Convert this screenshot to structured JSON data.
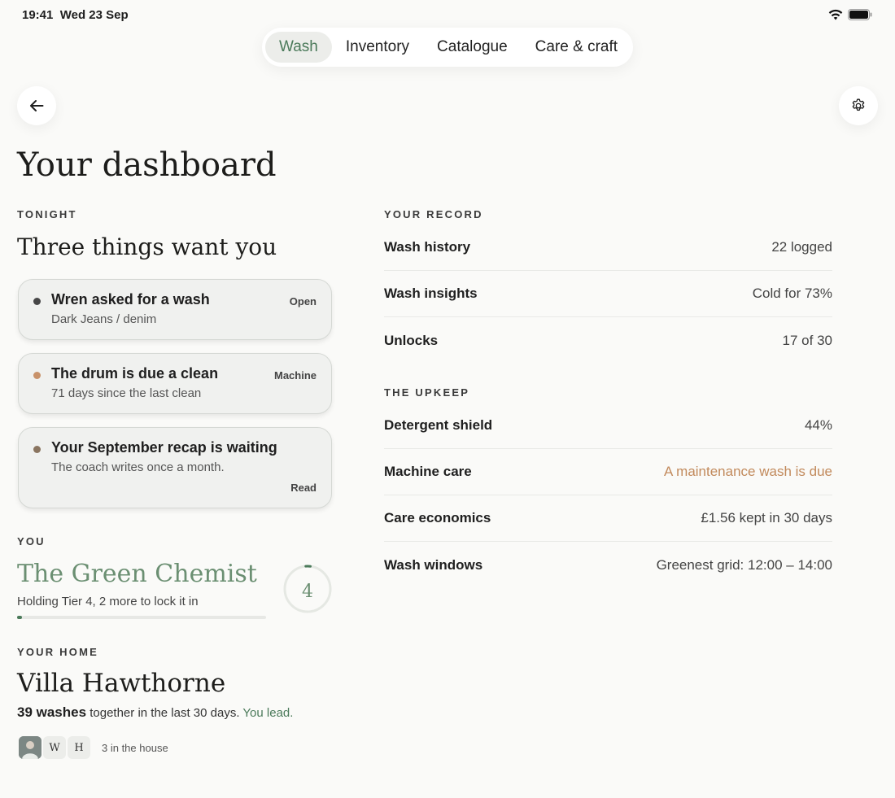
{
  "status": {
    "time": "19:41",
    "date": "Wed 23 Sep"
  },
  "nav": {
    "tabs": [
      "Wash",
      "Inventory",
      "Catalogue",
      "Care & craft"
    ],
    "active": 0
  },
  "page_title": "Your dashboard",
  "tonight": {
    "label": "TONIGHT",
    "title": "Three things want you",
    "cards": [
      {
        "title": "Wren asked for a wash",
        "sub": "Dark Jeans / denim",
        "tag": "Open",
        "dot_color": "#474747"
      },
      {
        "title": "The drum is due a clean",
        "sub": "71 days since the last clean",
        "tag": "Machine",
        "dot_color": "#c8926a"
      },
      {
        "title": "Your September recap is waiting",
        "sub": "The coach writes once a month.",
        "tag": "Read",
        "dot_color": "#8a7560"
      }
    ]
  },
  "you": {
    "label": "YOU",
    "title": "The Green Chemist",
    "sub": "Holding Tier 4, 2 more to lock it in",
    "tier": "4",
    "progress_fraction": 0.02,
    "ring_fraction": 0.02
  },
  "home": {
    "label": "YOUR HOME",
    "title": "Villa Hawthorne",
    "washes_strong": "39 washes",
    "washes_text": " together in the last 30 days. ",
    "lead": "You lead.",
    "members": [
      "W",
      "H"
    ],
    "count_text": "3 in the house"
  },
  "record": {
    "label": "YOUR RECORD",
    "rows": [
      {
        "label": "Wash history",
        "value": "22 logged"
      },
      {
        "label": "Wash insights",
        "value": "Cold for 73%"
      },
      {
        "label": "Unlocks",
        "value": "17 of 30"
      }
    ]
  },
  "upkeep": {
    "label": "THE UPKEEP",
    "rows": [
      {
        "label": "Detergent shield",
        "value": "44%"
      },
      {
        "label": "Machine care",
        "value": "A maintenance wash is due"
      },
      {
        "label": "Care economics",
        "value": "£1.56 kept in 30 days"
      },
      {
        "label": "Wash windows",
        "value": "Greenest grid: 12:00 – 14:00"
      }
    ]
  },
  "colors": {
    "accent": "#4b7a5a",
    "warn": "#c28a5c",
    "tier": "#6b8f72"
  }
}
